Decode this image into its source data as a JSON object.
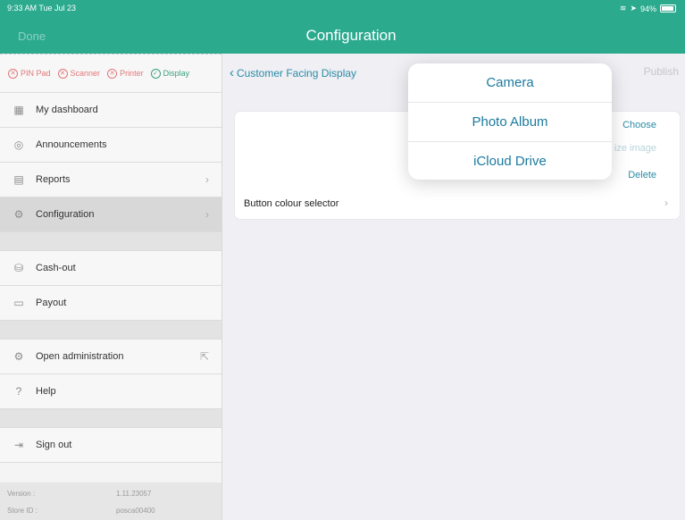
{
  "status_bar": {
    "time": "9:33 AM  Tue Jul 23",
    "battery": "94%",
    "battery_level": 0.94
  },
  "header": {
    "done": "Done",
    "title": "Configuration"
  },
  "device_status": [
    {
      "label": "PIN Pad",
      "ok": false
    },
    {
      "label": "Scanner",
      "ok": false
    },
    {
      "label": "Printer",
      "ok": false
    },
    {
      "label": "Display",
      "ok": true
    }
  ],
  "sidebar": {
    "my_dashboard": "My dashboard",
    "announcements": "Announcements",
    "reports": "Reports",
    "configuration": "Configuration",
    "cash_out": "Cash-out",
    "payout": "Payout",
    "open_administration": "Open administration",
    "help": "Help",
    "sign_out": "Sign out",
    "version_label": "Version :",
    "version_value": "1.11.23057",
    "store_label": "Store ID :",
    "store_value": "posca00400"
  },
  "content": {
    "back_label": "Customer Facing Display",
    "publish": "Publish",
    "choose": "Choose",
    "resize_partial": "ize image",
    "delete": "Delete",
    "button_colour_selector": "Button colour selector"
  },
  "popup": {
    "camera": "Camera",
    "photo_album": "Photo Album",
    "icloud_drive": "iCloud Drive"
  },
  "colors": {
    "header": "#2baa8e",
    "accent": "#2b8ca6",
    "error": "#e2777a",
    "ok": "#3aa17e"
  }
}
